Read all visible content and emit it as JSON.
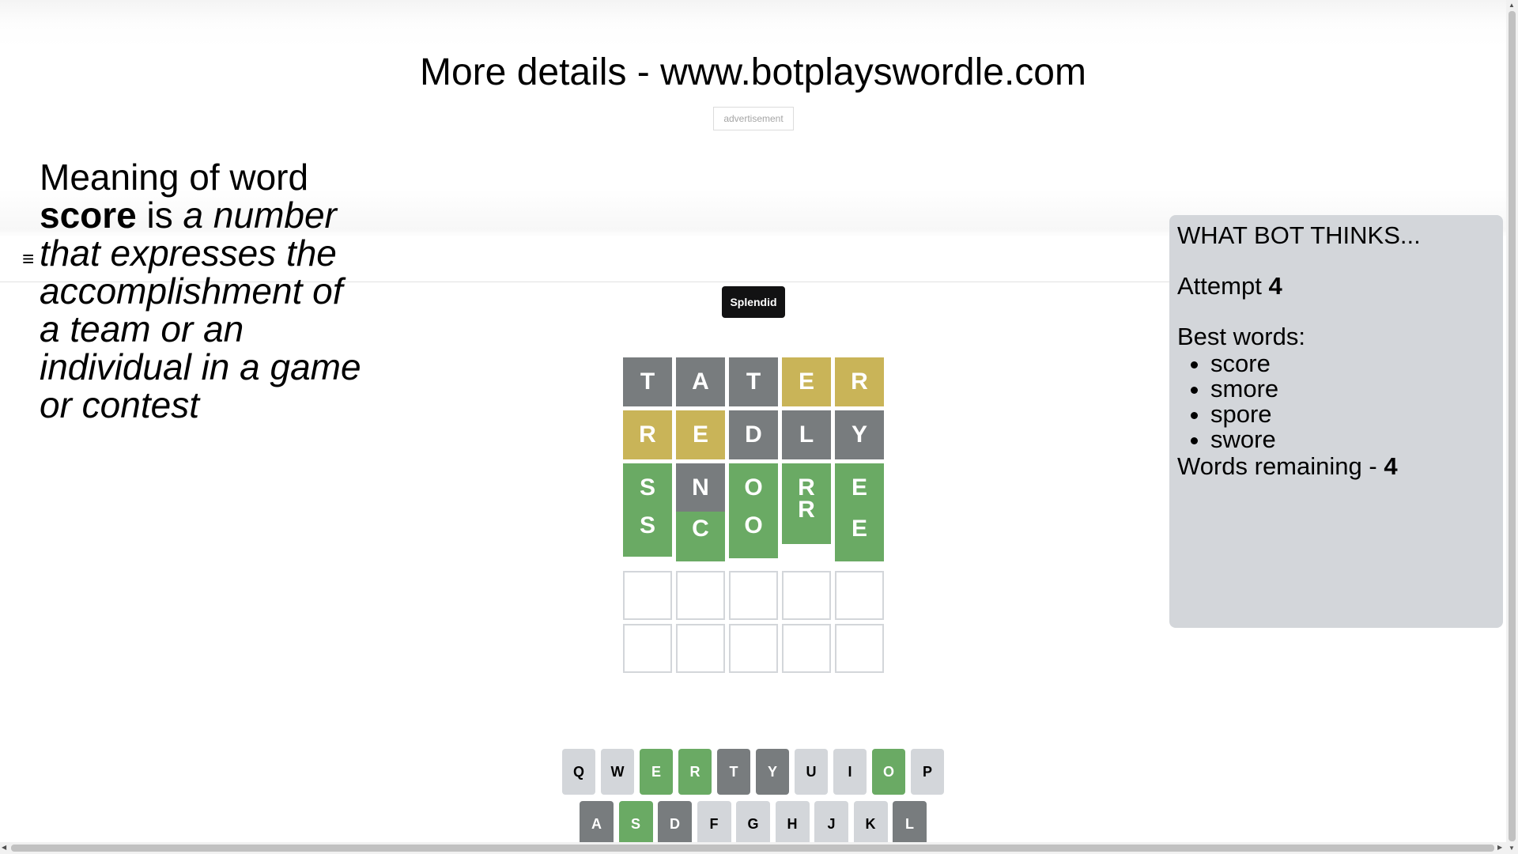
{
  "header": {
    "title": "More details - www.botplayswordle.com",
    "ad_label": "advertisement",
    "menu_icon": "≡"
  },
  "meaning": {
    "prefix": "Meaning of word",
    "word": "score",
    "is": "is",
    "definition": "a number that expresses the accomplishment of a team or an individual in a game or contest"
  },
  "toast": "Splendid",
  "board": {
    "rows": [
      [
        {
          "letter": "T",
          "state": "gray"
        },
        {
          "letter": "A",
          "state": "gray"
        },
        {
          "letter": "T",
          "state": "gray"
        },
        {
          "letter": "E",
          "state": "yellow"
        },
        {
          "letter": "R",
          "state": "yellow"
        }
      ],
      [
        {
          "letter": "R",
          "state": "yellow"
        },
        {
          "letter": "E",
          "state": "yellow"
        },
        {
          "letter": "D",
          "state": "gray"
        },
        {
          "letter": "L",
          "state": "gray"
        },
        {
          "letter": "Y",
          "state": "gray"
        }
      ],
      [
        {
          "letter": "S",
          "state": "green",
          "second": "S"
        },
        {
          "letter": "N",
          "state": "gray",
          "second": "C"
        },
        {
          "letter": "O",
          "state": "green",
          "second": "O"
        },
        {
          "letter": "R",
          "state": "green",
          "second": "R"
        },
        {
          "letter": "E",
          "state": "green",
          "second": "E"
        }
      ]
    ]
  },
  "bot": {
    "title": "WHAT BOT THINKS...",
    "attempt_label": "Attempt",
    "attempt_value": "4",
    "best_label": "Best words:",
    "best_words": [
      "score",
      "smore",
      "spore",
      "swore"
    ],
    "remaining_label": "Words remaining -",
    "remaining_value": "4"
  },
  "keyboard": {
    "row1": [
      {
        "key": "Q",
        "state": "default"
      },
      {
        "key": "W",
        "state": "default"
      },
      {
        "key": "E",
        "state": "green"
      },
      {
        "key": "R",
        "state": "green"
      },
      {
        "key": "T",
        "state": "gray"
      },
      {
        "key": "Y",
        "state": "gray"
      },
      {
        "key": "U",
        "state": "default"
      },
      {
        "key": "I",
        "state": "default"
      },
      {
        "key": "O",
        "state": "green"
      },
      {
        "key": "P",
        "state": "default"
      }
    ],
    "row2": [
      {
        "key": "A",
        "state": "gray"
      },
      {
        "key": "S",
        "state": "green"
      },
      {
        "key": "D",
        "state": "gray"
      },
      {
        "key": "F",
        "state": "default"
      },
      {
        "key": "G",
        "state": "default"
      },
      {
        "key": "H",
        "state": "default"
      },
      {
        "key": "J",
        "state": "default"
      },
      {
        "key": "K",
        "state": "default"
      },
      {
        "key": "L",
        "state": "gray"
      }
    ]
  },
  "colors": {
    "green": "#6aaa64",
    "yellow": "#c9b458",
    "gray": "#787c7e",
    "key_default": "#d3d6da"
  }
}
